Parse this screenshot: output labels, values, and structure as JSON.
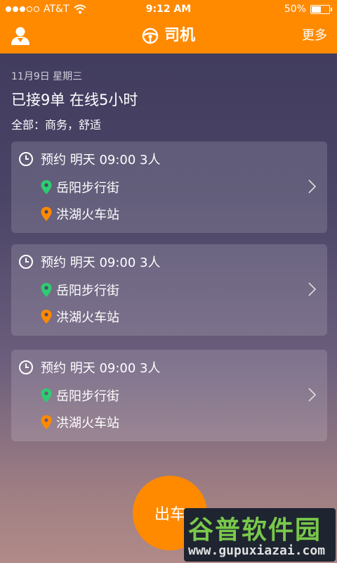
{
  "colors": {
    "accent": "#ff8a00",
    "origin_pin": "#2ecc71",
    "dest_pin": "#ff8a00"
  },
  "status_bar": {
    "carrier": "AT&T",
    "time": "9:12 AM",
    "battery": "50%"
  },
  "navbar": {
    "title": "司机",
    "more": "更多",
    "title_icon": "steering-wheel-icon",
    "user_icon": "user-icon"
  },
  "header": {
    "date": "11月9日 星期三",
    "summary": "已接9单 在线5小时",
    "types": "全部：商务，舒适"
  },
  "orders": [
    {
      "time_label": "预约 明天 09:00 3人",
      "origin": "岳阳步行街",
      "destination": "洪湖火车站"
    },
    {
      "time_label": "预约 明天 09:00 3人",
      "origin": "岳阳步行街",
      "destination": "洪湖火车站"
    },
    {
      "time_label": "预约 明天 09:00 3人",
      "origin": "岳阳步行街",
      "destination": "洪湖火车站"
    }
  ],
  "go_button": "出车",
  "watermark": {
    "title": "谷普软件园",
    "url": "www.gupuxiazai.com"
  }
}
